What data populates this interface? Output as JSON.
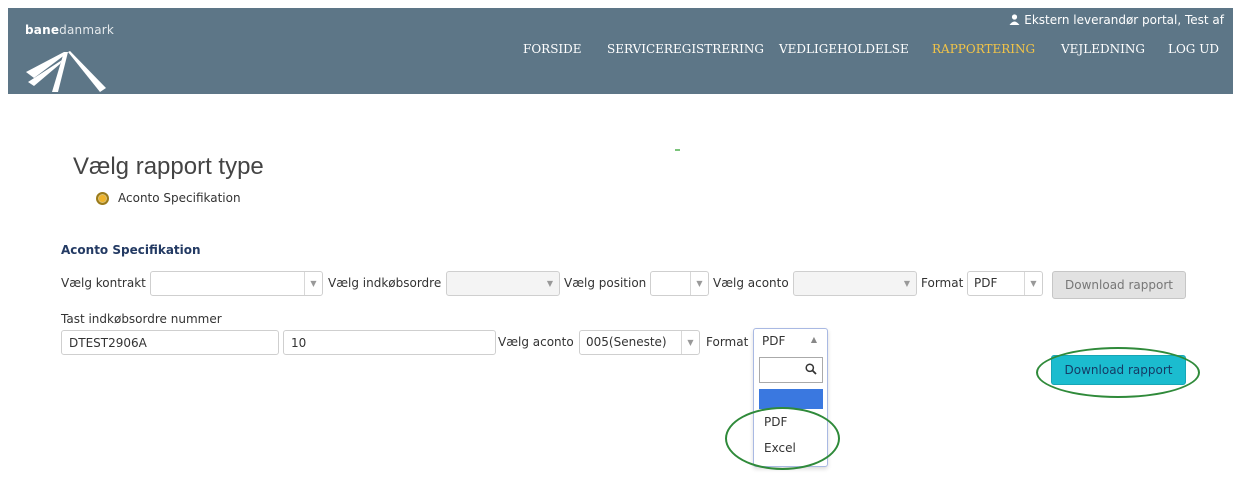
{
  "header": {
    "logo_bold": "bane",
    "logo_light": "danmark",
    "user_text": "Ekstern leverandør portal, Test af",
    "nav": [
      "FORSIDE",
      "SERVICEREGISTRERING",
      "VEDLIGEHOLDELSE",
      "RAPPORTERING",
      "VEJLEDNING",
      "LOG UD"
    ],
    "active_nav": "RAPPORTERING",
    "accent_color": "#f2c447",
    "bar_color": "#5d7687"
  },
  "report_type": {
    "title": "Vælg rapport type",
    "option": "Aconto Specifikation"
  },
  "form1": {
    "section_title": "Aconto Specifikation",
    "kontrakt_label": "Vælg kontrakt",
    "indkobsordre_label": "Vælg indkøbsordre",
    "position_label": "Vælg position",
    "aconto_label": "Vælg aconto",
    "format_label": "Format",
    "format_value": "PDF",
    "download_label": "Download rapport"
  },
  "form2": {
    "input_label": "Tast indkøbsordre nummer",
    "order_number": "DTEST2906A",
    "second_value": "10",
    "aconto_label": "Vælg aconto",
    "aconto_value": "005(Seneste)",
    "format_label": "Format",
    "format_value": "PDF",
    "format_options": [
      "PDF",
      "Excel"
    ],
    "download_label": "Download rapport",
    "button_color": "#1bbccf"
  },
  "icons": [
    "user-icon",
    "search-icon",
    "chevron-down-icon",
    "chevron-up-icon",
    "banedanmark-logo-icon"
  ]
}
